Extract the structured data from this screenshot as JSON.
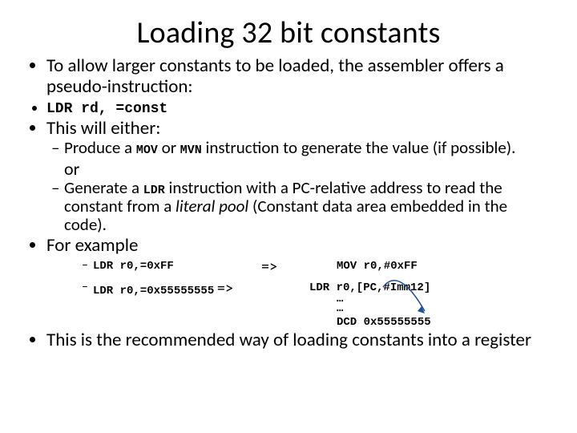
{
  "title": "Loading 32 bit constants",
  "bullets": {
    "b1": "To allow larger constants to be loaded, the assembler offers a pseudo-instruction:",
    "code1": "LDR rd, =const",
    "b2": "This will either:",
    "sub1_pre": "Produce a ",
    "sub1_m1": "MOV",
    "sub1_mid": " or ",
    "sub1_m2": "MVN",
    "sub1_post": " instruction to generate the value (if possible).",
    "or": "or",
    "sub2_pre": "Generate a ",
    "sub2_m1": "LDR",
    "sub2_post": " instruction with a PC-relative address to read the constant from a ",
    "sub2_em": "literal pool",
    "sub2_post2": " (Constant data area embedded in the code).",
    "b3": "For example",
    "ex1_l": "LDR r0,=0xFF",
    "ex1_arrow": "=>",
    "ex1_r": "MOV r0,#0xFF",
    "ex2_l": "LDR r0,=0x55555555",
    "ex2_arrow": "=>",
    "ex2_r1": "LDR r0,[PC,#Imm12]",
    "ex2_dots1": "…",
    "ex2_dots2": "…",
    "ex2_dcd": "DCD 0x55555555",
    "b4": "This is the recommended way of loading constants into a register"
  }
}
